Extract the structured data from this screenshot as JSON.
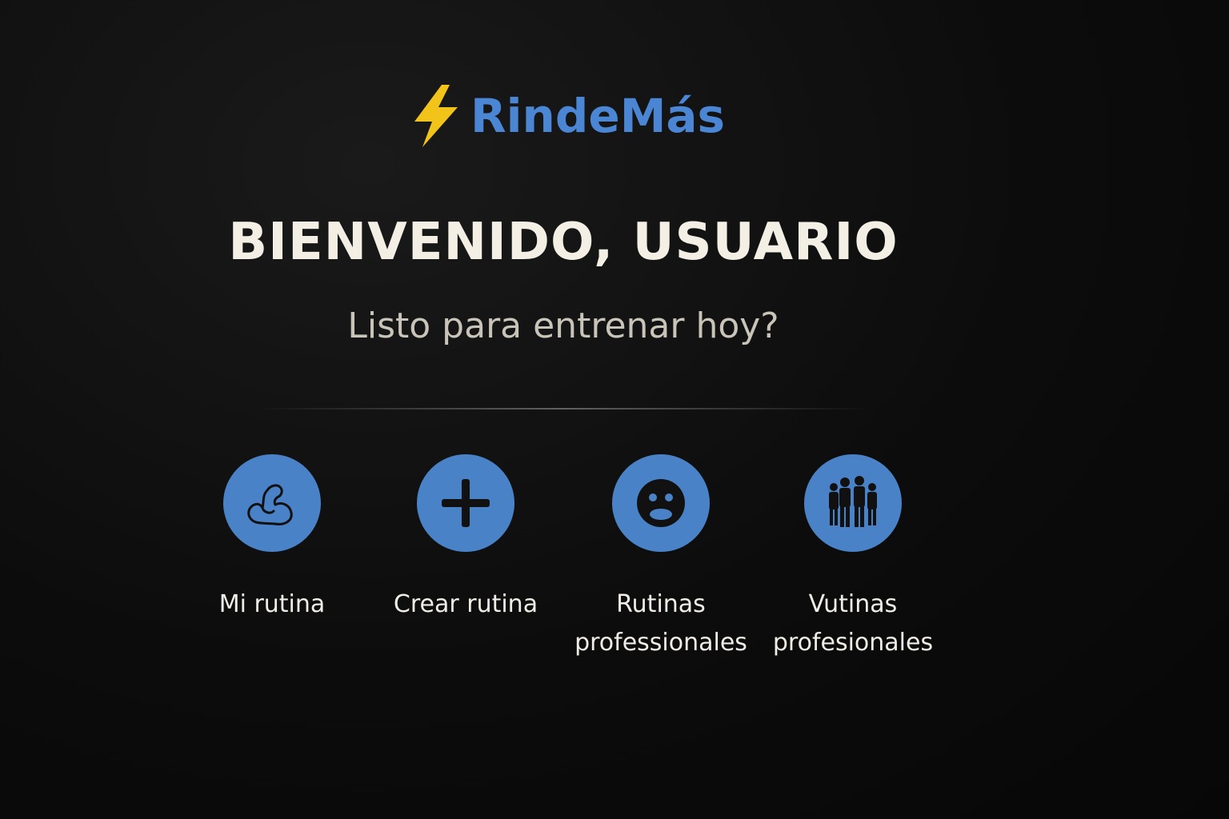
{
  "app": {
    "name": "RindeMás",
    "logo_icon": "lightning-bolt-icon",
    "brand_color": "#4a86d4",
    "bolt_color": "#f2c318"
  },
  "welcome": {
    "title": "BIENVENIDO, USUARIO",
    "subtitle": "Listo para entrenar hoy?"
  },
  "actions": [
    {
      "label": "Mi rutina",
      "icon": "flexed-arm-icon"
    },
    {
      "label": "Crear rutina",
      "icon": "plus-icon"
    },
    {
      "label": "Rutinas\nprofessionales",
      "icon": "face-icon"
    },
    {
      "label": "Vutinas\nprofesionales",
      "icon": "group-people-icon"
    }
  ],
  "colors": {
    "background": "#0a0a0a",
    "action_circle": "#4a82c8",
    "title_text": "#f3efe4",
    "subtitle_text": "#c9c4b9"
  }
}
